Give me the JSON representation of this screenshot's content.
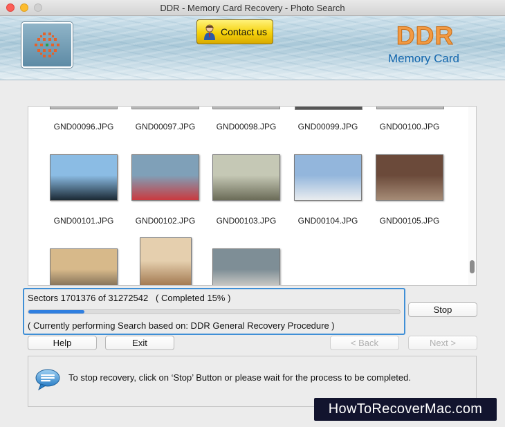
{
  "window": {
    "title": "DDR - Memory Card Recovery - Photo Search"
  },
  "header": {
    "contact_label": "Contact us",
    "brand_title": "DDR",
    "brand_subtitle": "Memory Card"
  },
  "thumbnails": [
    {
      "name": "GND00096.JPG",
      "palette": [
        "#8a7a68",
        "#d8d0c6"
      ]
    },
    {
      "name": "GND00097.JPG",
      "palette": [
        "#6e7070",
        "#c9c9c9"
      ]
    },
    {
      "name": "GND00098.JPG",
      "palette": [
        "#8b8b8b",
        "#d1d1d1"
      ]
    },
    {
      "name": "GND00099.JPG",
      "palette": [
        "#4c3f35",
        "#9a8b7c"
      ]
    },
    {
      "name": "GND00100.JPG",
      "palette": [
        "#777",
        "#ccc"
      ]
    },
    {
      "name": "GND00101.JPG",
      "palette": [
        "#8bbce4",
        "#1b2a35"
      ]
    },
    {
      "name": "GND00102.JPG",
      "palette": [
        "#7fa0b8",
        "#c93a3f"
      ]
    },
    {
      "name": "GND00103.JPG",
      "palette": [
        "#c5c8b5",
        "#6b6c58"
      ]
    },
    {
      "name": "GND00104.JPG",
      "palette": [
        "#93b6dc",
        "#e9ecef"
      ]
    },
    {
      "name": "GND00105.JPG",
      "palette": [
        "#6b4a3a",
        "#a58b76"
      ]
    },
    {
      "name": "",
      "palette": [
        "#d7b98a",
        "#5a4d40"
      ]
    },
    {
      "name": "",
      "palette": [
        "#e5cfae",
        "#9a6e44"
      ]
    },
    {
      "name": "",
      "palette": [
        "#7e8e96",
        "#efe6dc"
      ]
    }
  ],
  "progress": {
    "sectors_text": "Sectors 1701376 of 31272542   ( Completed 15% )",
    "fraction": 0.15,
    "procedure_text": "( Currently performing Search based on: DDR General Recovery Procedure )"
  },
  "buttons": {
    "stop": "Stop",
    "help": "Help",
    "exit": "Exit",
    "back": "< Back",
    "next": "Next >"
  },
  "info": {
    "message": "To stop recovery, click on ‘Stop’ Button or please wait for the process to be completed."
  },
  "watermark": "HowToRecoverMac.com"
}
